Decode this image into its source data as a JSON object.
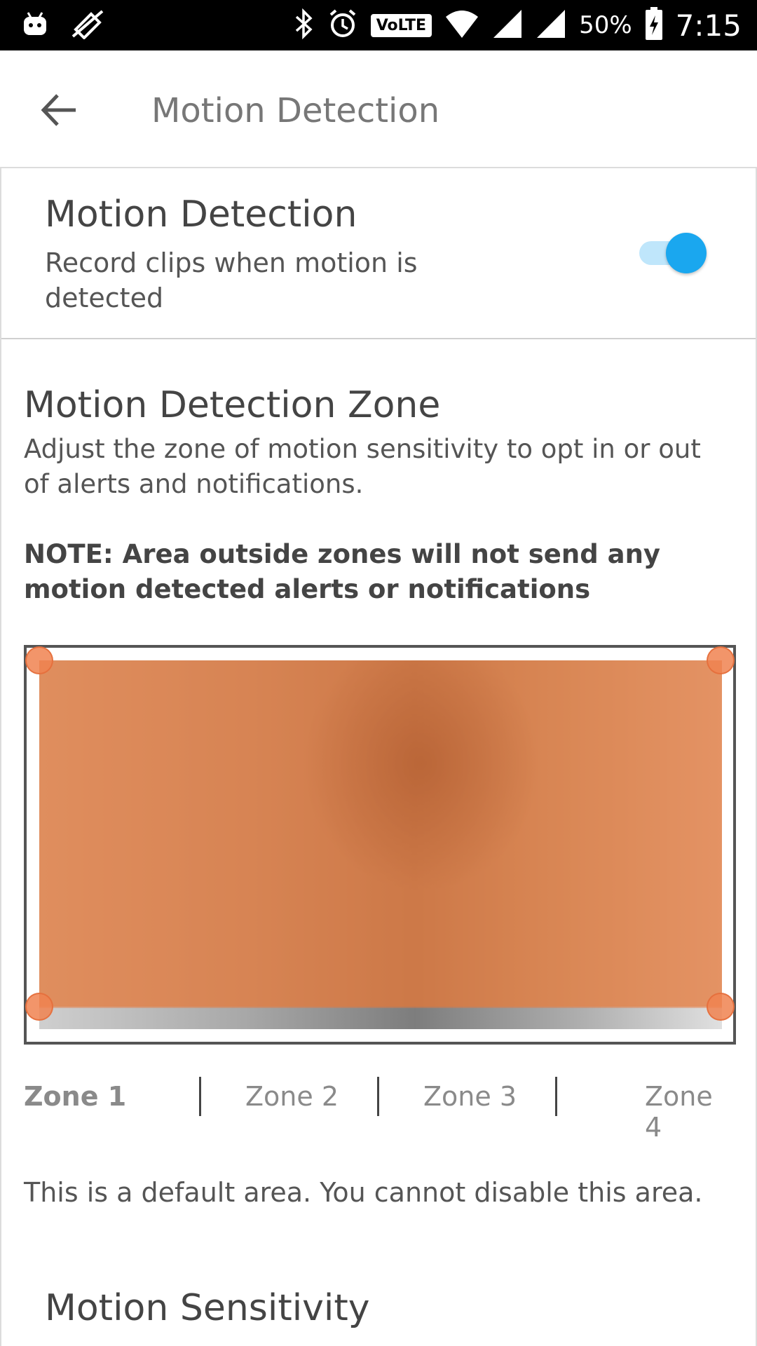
{
  "status_bar": {
    "battery_percent": "50%",
    "time": "7:15",
    "volte_label": "VoLTE",
    "icons": [
      "android-icon",
      "mute-icon",
      "bluetooth-icon",
      "alarm-icon",
      "wifi-icon",
      "signal-icon",
      "signal-icon",
      "battery-charging-icon"
    ]
  },
  "app_bar": {
    "title": "Motion Detection",
    "back_icon": "arrow-left-icon"
  },
  "motion_detection": {
    "title": "Motion Detection",
    "description": "Record clips when motion is detected",
    "enabled": true
  },
  "zone_section": {
    "title": "Motion Detection Zone",
    "description": "Adjust the zone of motion sensitivity to opt in or out of alerts and notifications.",
    "note": "NOTE: Area outside zones will not send any motion detected alerts or notifications"
  },
  "zone_tabs": [
    {
      "label": "Zone 1",
      "active": true
    },
    {
      "label": "Zone 2",
      "active": false
    },
    {
      "label": "Zone 3",
      "active": false
    },
    {
      "label": "Zone 4",
      "active": false
    }
  ],
  "default_area_note": "This is a default area. You cannot disable this area.",
  "sensitivity": {
    "title": "Motion Sensitivity"
  },
  "colors": {
    "accent": "#1aa7ef",
    "zone_overlay": "#e8783c"
  }
}
